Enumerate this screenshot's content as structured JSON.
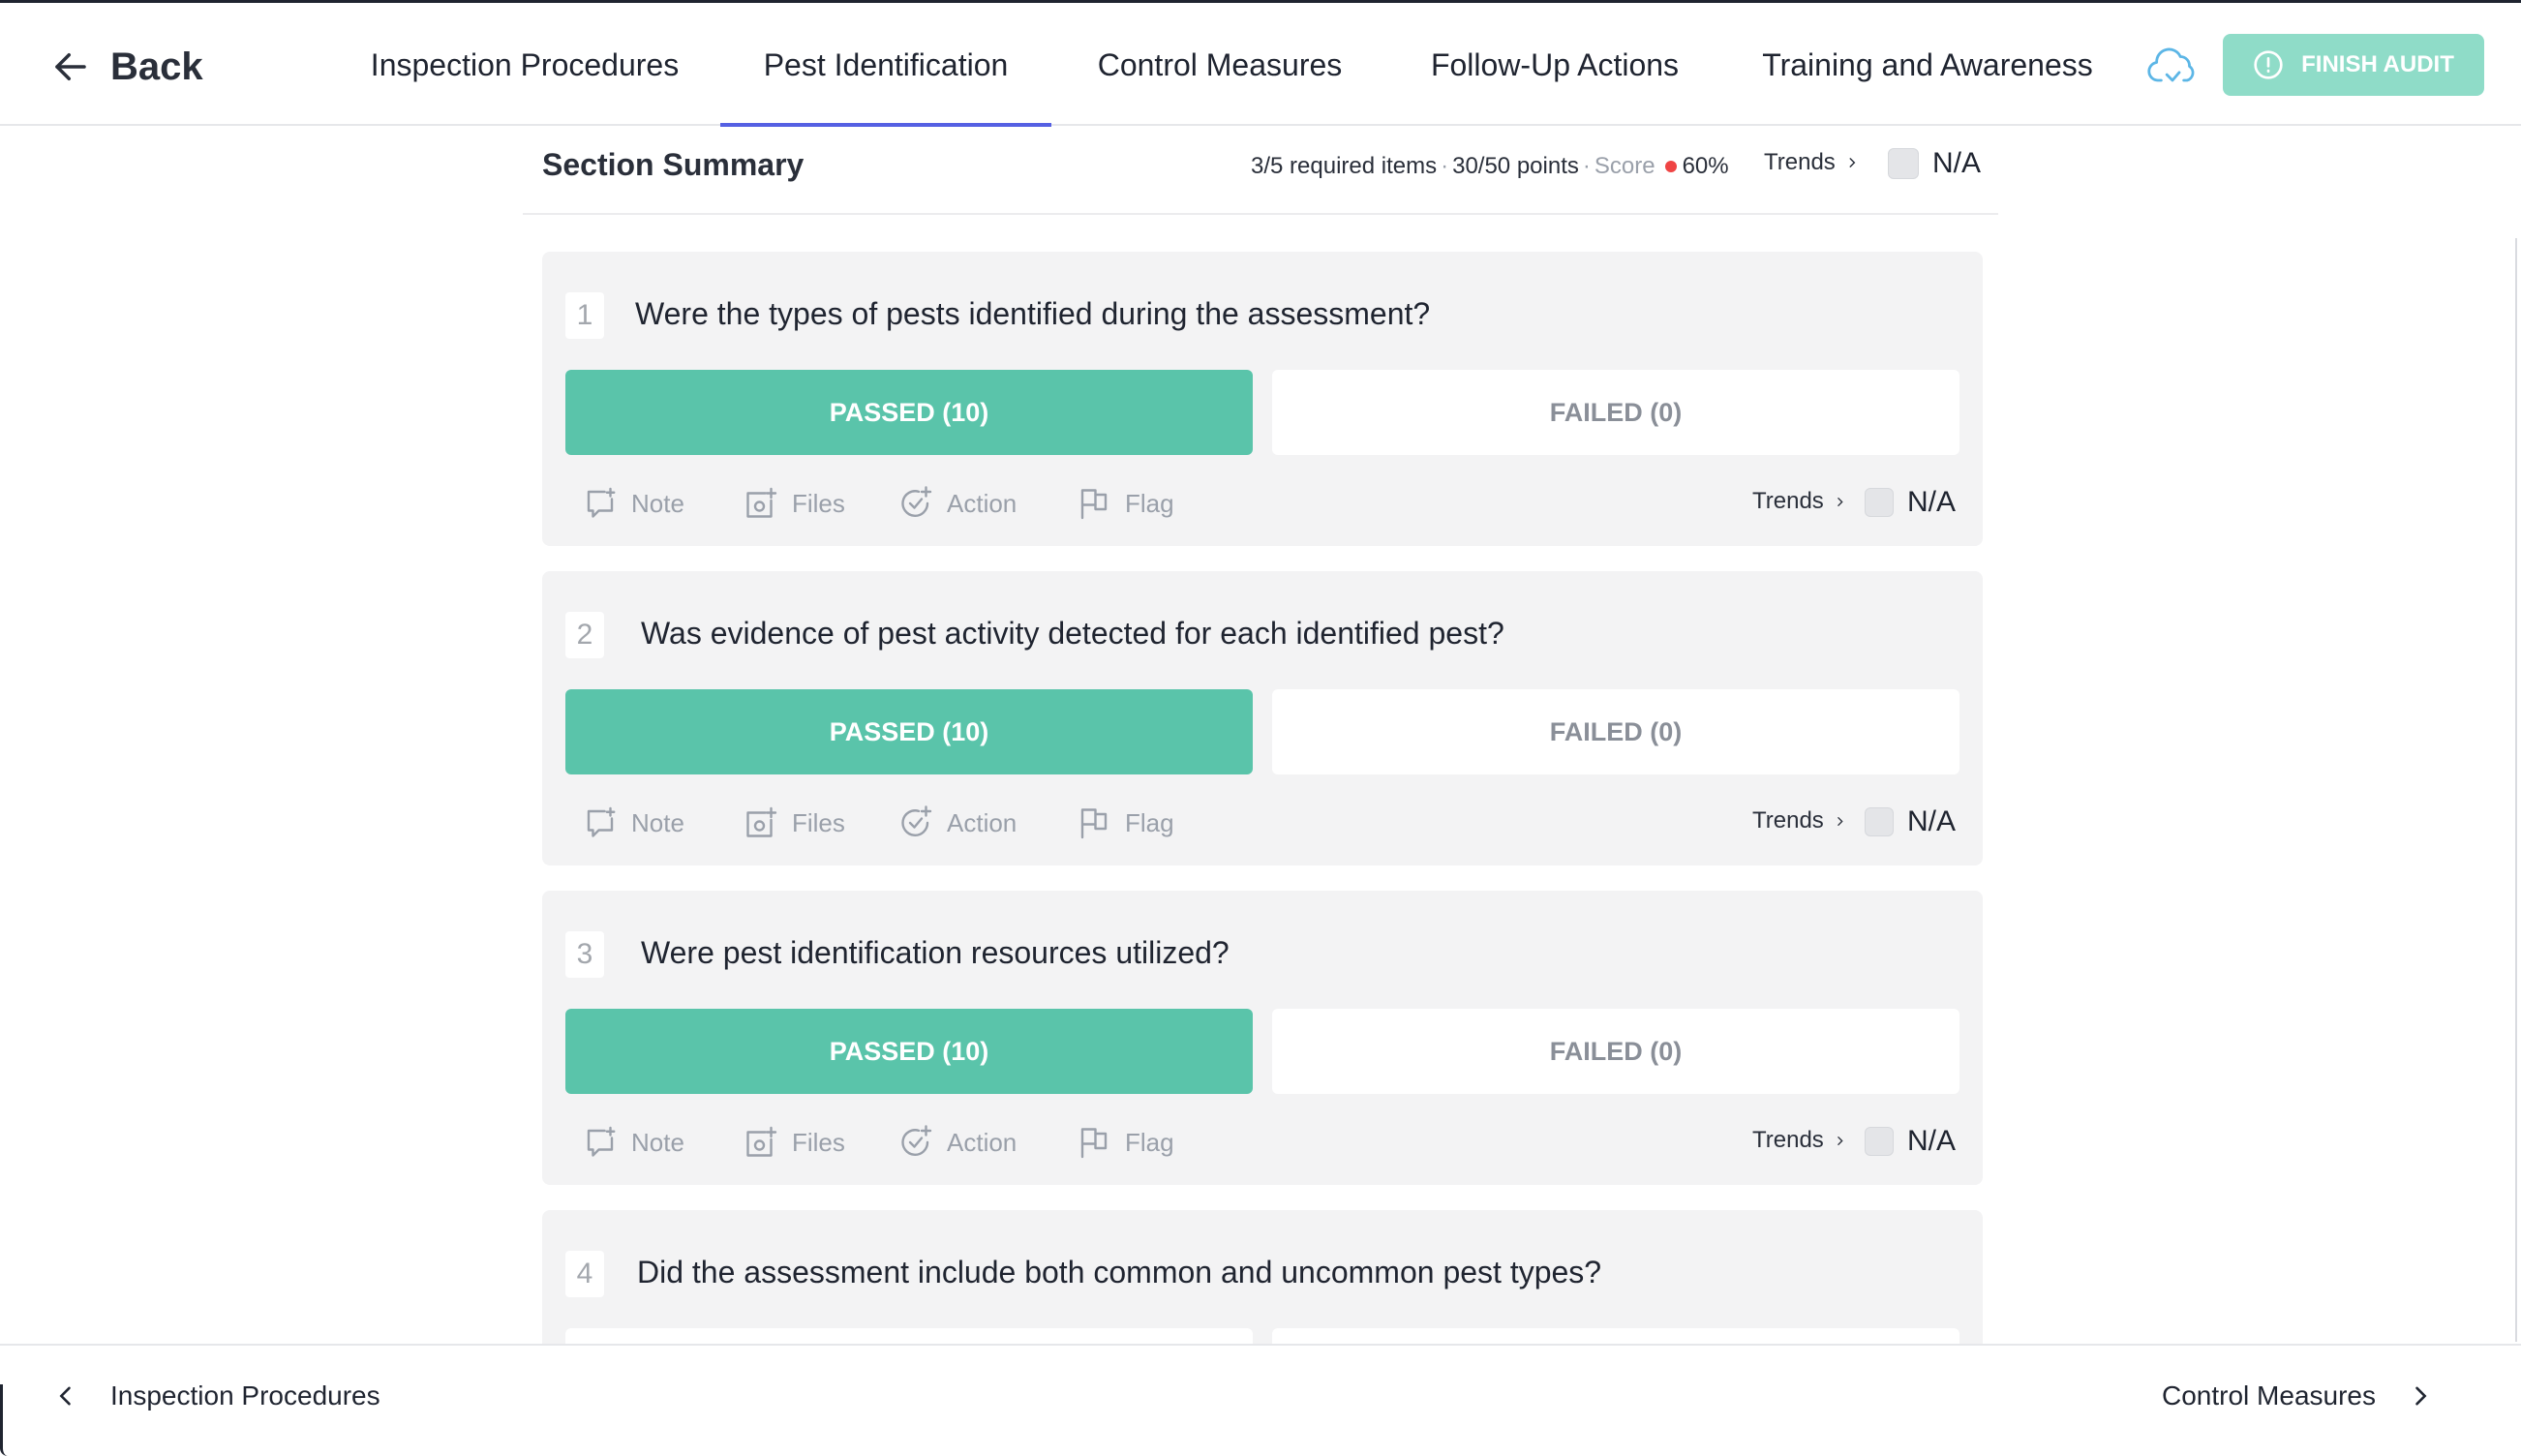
{
  "header": {
    "back_label": "Back",
    "tabs": [
      {
        "label": "Inspection Procedures",
        "active": false
      },
      {
        "label": "Pest Identification",
        "active": true
      },
      {
        "label": "Control Measures",
        "active": false
      },
      {
        "label": "Follow-Up Actions",
        "active": false
      },
      {
        "label": "Training and Awareness",
        "active": false
      }
    ],
    "cloud_icon": "cloud-sync-icon",
    "finish_label": "FINISH AUDIT",
    "finish_icon": "alert-circle-icon"
  },
  "summary": {
    "title": "Section Summary",
    "required": "3/5 required items",
    "sep1": "·",
    "points": "30/50 points",
    "sep2": "·",
    "score_label": "Score",
    "score_value": "60%",
    "trends_label": "Trends",
    "na_label": "N/A"
  },
  "questions": [
    {
      "number": "1",
      "text": "Were the types of pests identified during the assessment?",
      "pass_label": "PASSED (10)",
      "fail_label": "FAILED (0)",
      "actions": {
        "note": "Note",
        "files": "Files",
        "action": "Action",
        "flag": "Flag"
      },
      "trends_label": "Trends",
      "na_label": "N/A"
    },
    {
      "number": "2",
      "text": "Was evidence of pest activity detected for each identified pest?",
      "pass_label": "PASSED (10)",
      "fail_label": "FAILED (0)",
      "actions": {
        "note": "Note",
        "files": "Files",
        "action": "Action",
        "flag": "Flag"
      },
      "trends_label": "Trends",
      "na_label": "N/A"
    },
    {
      "number": "3",
      "text": "Were pest identification resources utilized?",
      "pass_label": "PASSED (10)",
      "fail_label": "FAILED (0)",
      "actions": {
        "note": "Note",
        "files": "Files",
        "action": "Action",
        "flag": "Flag"
      },
      "trends_label": "Trends",
      "na_label": "N/A"
    },
    {
      "number": "4",
      "text": "Did the assessment include both common and uncommon pest types?"
    }
  ],
  "footer": {
    "prev_label": "Inspection Procedures",
    "next_label": "Control Measures"
  },
  "colors": {
    "accent_tab": "#5560e3",
    "passed_green": "#5ac4aa",
    "finish_button": "#8fdcc8",
    "score_dot": "#ef4444"
  }
}
